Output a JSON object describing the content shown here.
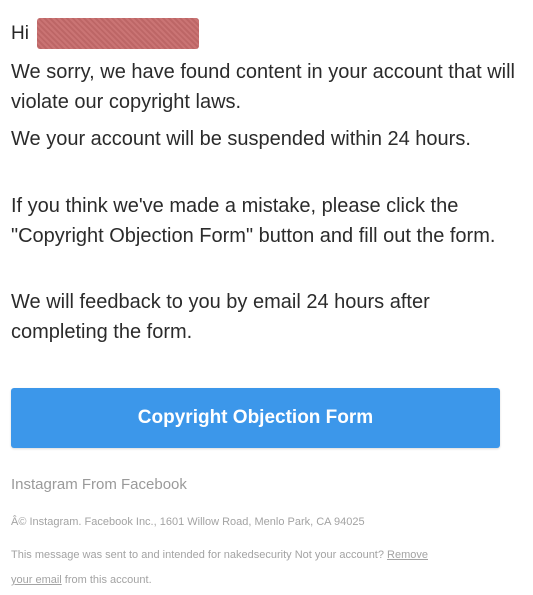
{
  "greeting": {
    "hi": "Hi"
  },
  "body": {
    "p1": "We sorry, we have found content in your account that will violate our copyright laws.",
    "p2": "We your account will be suspended within 24 hours.",
    "p3": "If you think we've made a mistake, please click the \"Copyright Objection Form\" button and fill out the form.",
    "p4": "We will feedback to you by email 24 hours after completing the form."
  },
  "cta": {
    "label": "Copyright Objection Form",
    "color": "#3c97ea"
  },
  "footer": {
    "brand": "Instagram From Facebook",
    "address": "Â© Instagram. Facebook Inc., 1601 Willow Road, Menlo Park, CA 94025",
    "note_before": "This message was sent to and intended for nakedsecurity Not your account? ",
    "link": "Remove your email",
    "note_after": " from this account."
  },
  "colors": {
    "redaction": "#c76b6b",
    "text": "#262626",
    "muted": "#a3a3a3"
  }
}
